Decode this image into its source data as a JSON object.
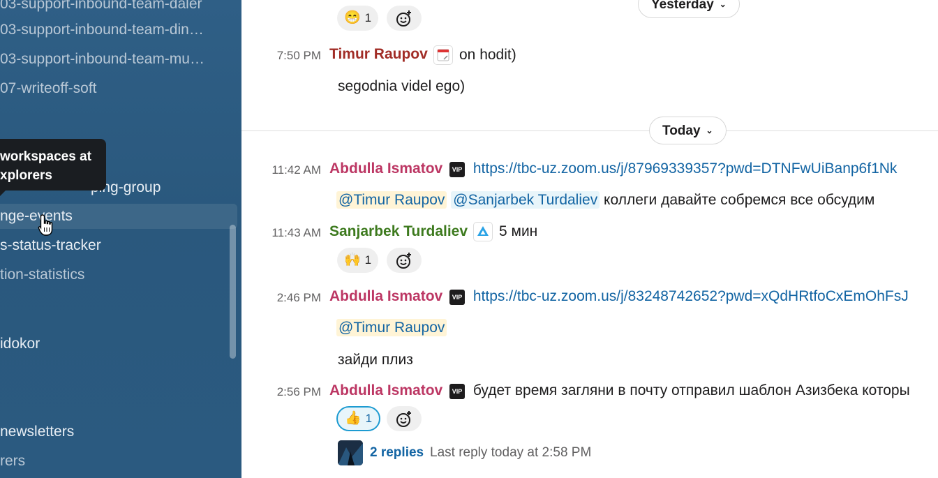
{
  "sidebar": {
    "channels": [
      "03-support-inbound-team-daler",
      "03-support-inbound-team-din…",
      "03-support-inbound-team-mu…",
      "07-writeoff-soft",
      "ping-group",
      "nge-events",
      "s-status-tracker",
      "tion-statistics",
      "idokor",
      "newsletters",
      "rers"
    ],
    "tooltip_line1": "workspaces at",
    "tooltip_line2": "xplorers"
  },
  "chat": {
    "pills": {
      "yesterday": "Yesterday",
      "today": "Today"
    },
    "messages": [
      {
        "time": "7:50 PM",
        "author": "Timur Raupov",
        "text": "on hodit)",
        "body": "segodnia videl ego)"
      },
      {
        "time": "11:42 AM",
        "author": "Abdulla Ismatov",
        "badge": "VIP",
        "link": "https://tbc-uz.zoom.us/j/87969339357?pwd=DTNFwUiBanp6f1Nk",
        "mention1": "@Timur Raupov",
        "mention2": "@Sanjarbek Turdaliev",
        "text": "коллеги давайте собремся все обсудим"
      },
      {
        "time": "11:43 AM",
        "author": "Sanjarbek Turdaliev",
        "text": "5 мин"
      },
      {
        "time": "2:46 PM",
        "author": "Abdulla Ismatov",
        "badge": "VIP",
        "link": "https://tbc-uz.zoom.us/j/83248742652?pwd=xQdHRtfoCxEmOhFsJ",
        "mention1": "@Timur Raupov",
        "text": "зайди плиз"
      },
      {
        "time": "2:56 PM",
        "author": "Abdulla Ismatov",
        "badge": "VIP",
        "text": "будет время загляни в почту отправил шаблон Азизбека которы"
      }
    ],
    "reactions": {
      "grin_count": "1",
      "raised_hands_count": "1",
      "thumbs_count": "1"
    },
    "thread": {
      "replies": "2 replies",
      "last_reply": "Last reply today at 2:58 PM"
    }
  },
  "colors": {
    "sidebar_bg": "#2b5a80",
    "link": "#1264a3",
    "author_red": "#a12c26",
    "author_pink": "#bc3663",
    "author_green": "#3d7a1e"
  }
}
